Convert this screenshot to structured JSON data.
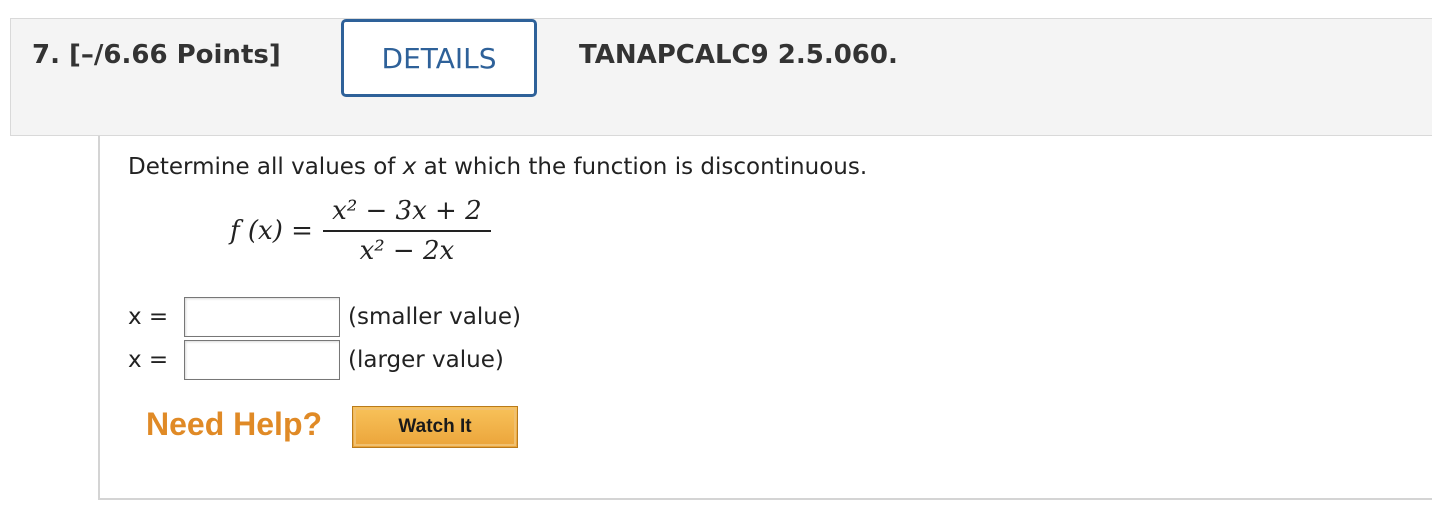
{
  "question": {
    "number_points": "7. [–/6.66 Points]",
    "details_label": "DETAILS",
    "code": "TANAPCALC9 2.5.060."
  },
  "problem": {
    "prompt_before": "Determine all values of ",
    "prompt_var": "x",
    "prompt_after": " at which the function is discontinuous.",
    "function_lhs": "f (x) =",
    "numerator": "x² − 3x + 2",
    "denominator": "x² − 2x"
  },
  "answers": [
    {
      "label": "x =",
      "value": "",
      "hint": "(smaller value)"
    },
    {
      "label": "x =",
      "value": "",
      "hint": "(larger value)"
    }
  ],
  "help": {
    "label": "Need Help?",
    "watch_label": "Watch It"
  },
  "colors": {
    "details_accent": "#2e6199",
    "help_orange": "#e08a26",
    "watch_button": "#eba43a"
  }
}
